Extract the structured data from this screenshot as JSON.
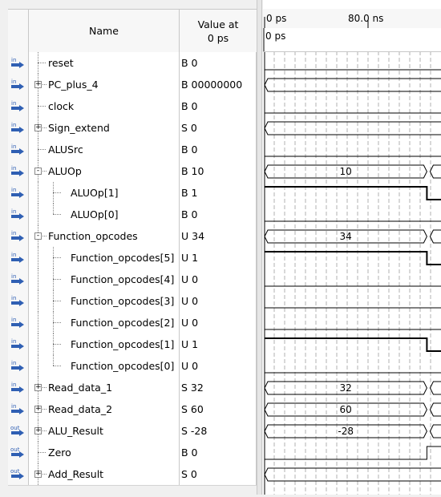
{
  "header": {
    "name_label": "Name",
    "value_label_line1": "Value at",
    "value_label_line2": "0 ps"
  },
  "timeline": {
    "ticks": [
      "0 ps",
      "80.0 ns"
    ],
    "cursor_label": "0 ps"
  },
  "signals": [
    {
      "name": "reset",
      "value": "B 0",
      "dir": "in",
      "depth": 0,
      "expander": null,
      "kind": "bit",
      "start": 0,
      "trans": [],
      "labels": []
    },
    {
      "name": "PC_plus_4",
      "value": "B 00000000",
      "dir": "in",
      "depth": 0,
      "expander": "+",
      "kind": "bus",
      "start": 0,
      "trans": [],
      "labels": []
    },
    {
      "name": "clock",
      "value": "B 0",
      "dir": "in",
      "depth": 0,
      "expander": null,
      "kind": "bit",
      "start": 0,
      "trans": [],
      "labels": []
    },
    {
      "name": "Sign_extend",
      "value": "S 0",
      "dir": "in",
      "depth": 0,
      "expander": "+",
      "kind": "bus",
      "start": 0,
      "trans": [],
      "labels": []
    },
    {
      "name": "ALUSrc",
      "value": "B 0",
      "dir": "in",
      "depth": 0,
      "expander": null,
      "kind": "bit",
      "start": 0,
      "trans": [],
      "labels": []
    },
    {
      "name": "ALUOp",
      "value": "B 10",
      "dir": "in",
      "depth": 0,
      "expander": "-",
      "kind": "bus",
      "start": 0,
      "trans": [
        0.92
      ],
      "labels": [
        "10"
      ]
    },
    {
      "name": "ALUOp[1]",
      "value": "B 1",
      "dir": "in",
      "depth": 1,
      "expander": null,
      "kind": "bit",
      "start": 1,
      "trans": [
        0.92
      ],
      "labels": []
    },
    {
      "name": "ALUOp[0]",
      "value": "B 0",
      "dir": "in",
      "depth": 1,
      "expander": null,
      "kind": "bit",
      "start": 0,
      "trans": [],
      "labels": []
    },
    {
      "name": "Function_opcodes",
      "value": "U 34",
      "dir": "in",
      "depth": 0,
      "expander": "-",
      "kind": "bus",
      "start": 0,
      "trans": [
        0.92
      ],
      "labels": [
        "34"
      ]
    },
    {
      "name": "Function_opcodes[5]",
      "value": "U 1",
      "dir": "in",
      "depth": 1,
      "expander": null,
      "kind": "bit",
      "start": 1,
      "trans": [
        0.92
      ],
      "labels": []
    },
    {
      "name": "Function_opcodes[4]",
      "value": "U 0",
      "dir": "in",
      "depth": 1,
      "expander": null,
      "kind": "bit",
      "start": 0,
      "trans": [],
      "labels": []
    },
    {
      "name": "Function_opcodes[3]",
      "value": "U 0",
      "dir": "in",
      "depth": 1,
      "expander": null,
      "kind": "bit",
      "start": 0,
      "trans": [],
      "labels": []
    },
    {
      "name": "Function_opcodes[2]",
      "value": "U 0",
      "dir": "in",
      "depth": 1,
      "expander": null,
      "kind": "bit",
      "start": 0,
      "trans": [],
      "labels": []
    },
    {
      "name": "Function_opcodes[1]",
      "value": "U 1",
      "dir": "in",
      "depth": 1,
      "expander": null,
      "kind": "bit",
      "start": 1,
      "trans": [
        0.92
      ],
      "labels": []
    },
    {
      "name": "Function_opcodes[0]",
      "value": "U 0",
      "dir": "in",
      "depth": 1,
      "expander": null,
      "kind": "bit",
      "start": 0,
      "trans": [],
      "labels": []
    },
    {
      "name": "Read_data_1",
      "value": "S 32",
      "dir": "in",
      "depth": 0,
      "expander": "+",
      "kind": "bus",
      "start": 0,
      "trans": [
        0.92
      ],
      "labels": [
        "32"
      ]
    },
    {
      "name": "Read_data_2",
      "value": "S 60",
      "dir": "in",
      "depth": 0,
      "expander": "+",
      "kind": "bus",
      "start": 0,
      "trans": [
        0.92
      ],
      "labels": [
        "60"
      ]
    },
    {
      "name": "ALU_Result",
      "value": "S -28",
      "dir": "out",
      "depth": 0,
      "expander": "+",
      "kind": "bus",
      "start": 0,
      "trans": [
        0.92
      ],
      "labels": [
        "-28"
      ]
    },
    {
      "name": "Zero",
      "value": "B 0",
      "dir": "out",
      "depth": 0,
      "expander": null,
      "kind": "bit",
      "start": 0,
      "trans": [
        0.92
      ],
      "labels": []
    },
    {
      "name": "Add_Result",
      "value": "S 0",
      "dir": "out",
      "depth": 0,
      "expander": "+",
      "kind": "bus",
      "start": 0,
      "trans": [],
      "labels": []
    }
  ],
  "colors": {
    "in_icon": "#2f5fb3",
    "out_icon": "#2f5fb3",
    "grid": "#b0b0b0"
  },
  "icons": {
    "in": "input-pin-icon",
    "out": "output-pin-icon"
  }
}
